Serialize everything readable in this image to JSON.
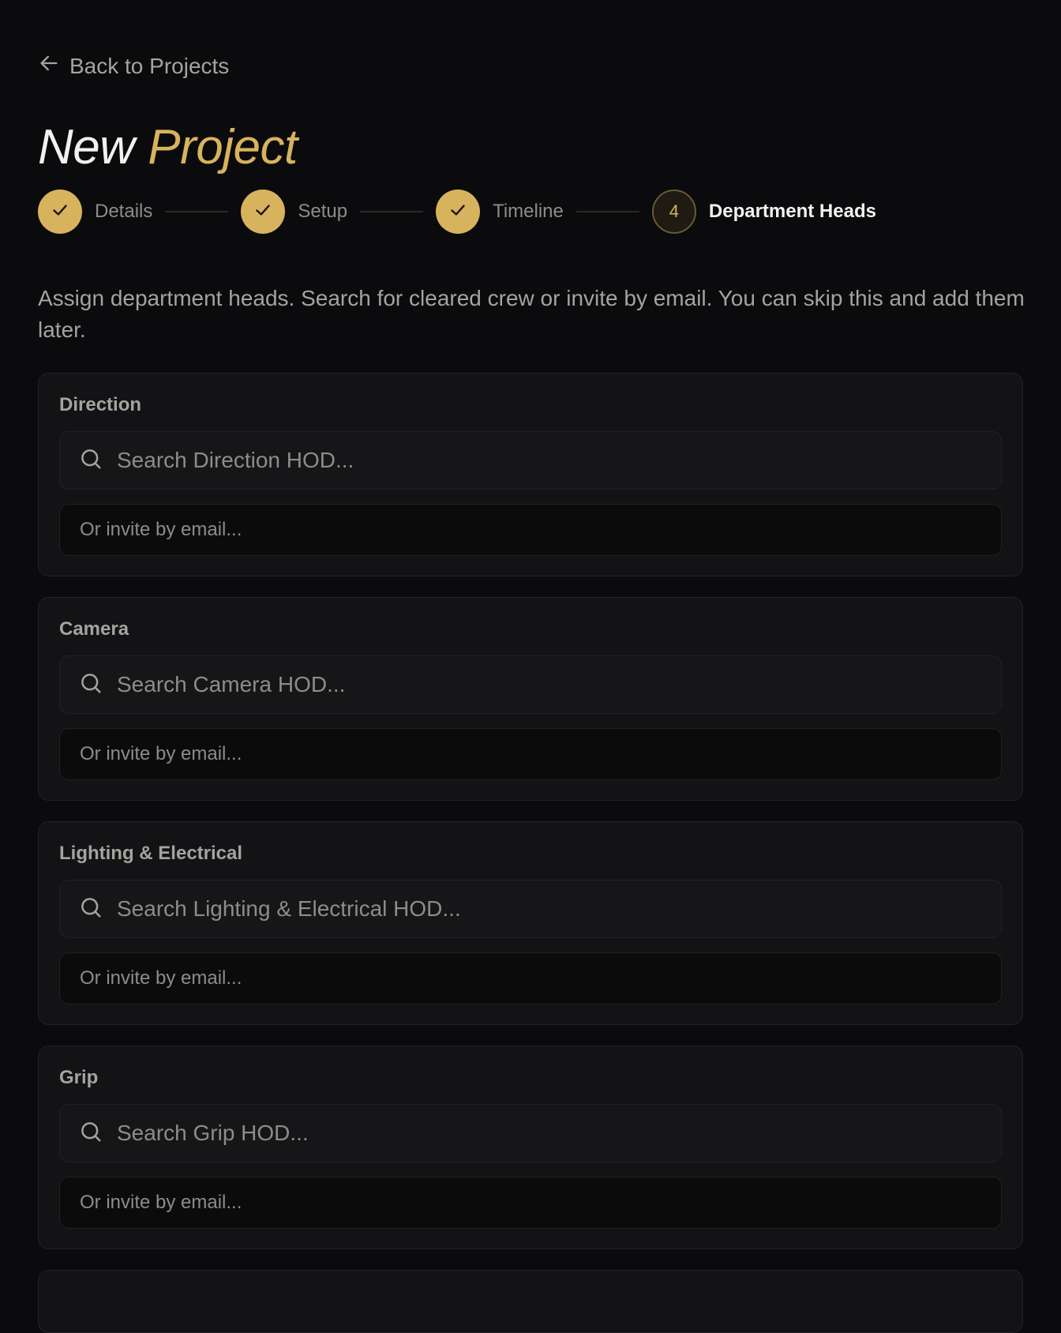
{
  "nav": {
    "back_label": "Back to Projects"
  },
  "title": {
    "word1": "New",
    "word2": "Project"
  },
  "steps": [
    {
      "label": "Details",
      "status": "complete"
    },
    {
      "label": "Setup",
      "status": "complete"
    },
    {
      "label": "Timeline",
      "status": "complete"
    },
    {
      "label": "Department Heads",
      "status": "current",
      "number": "4"
    }
  ],
  "intro": "Assign department heads. Search for cleared crew or invite by email. You can skip this and add them later.",
  "departments": [
    {
      "name": "Direction",
      "search_placeholder": "Search Direction HOD...",
      "email_placeholder": "Or invite by email..."
    },
    {
      "name": "Camera",
      "search_placeholder": "Search Camera HOD...",
      "email_placeholder": "Or invite by email..."
    },
    {
      "name": "Lighting & Electrical",
      "search_placeholder": "Search Lighting & Electrical HOD...",
      "email_placeholder": "Or invite by email..."
    },
    {
      "name": "Grip",
      "search_placeholder": "Search Grip HOD...",
      "email_placeholder": "Or invite by email..."
    }
  ],
  "colors": {
    "accent": "#d8b35d",
    "background": "#0b0b0d",
    "card": "#131315"
  },
  "icons": {
    "back": "arrow-left-icon",
    "complete": "check-icon",
    "search": "search-icon"
  }
}
